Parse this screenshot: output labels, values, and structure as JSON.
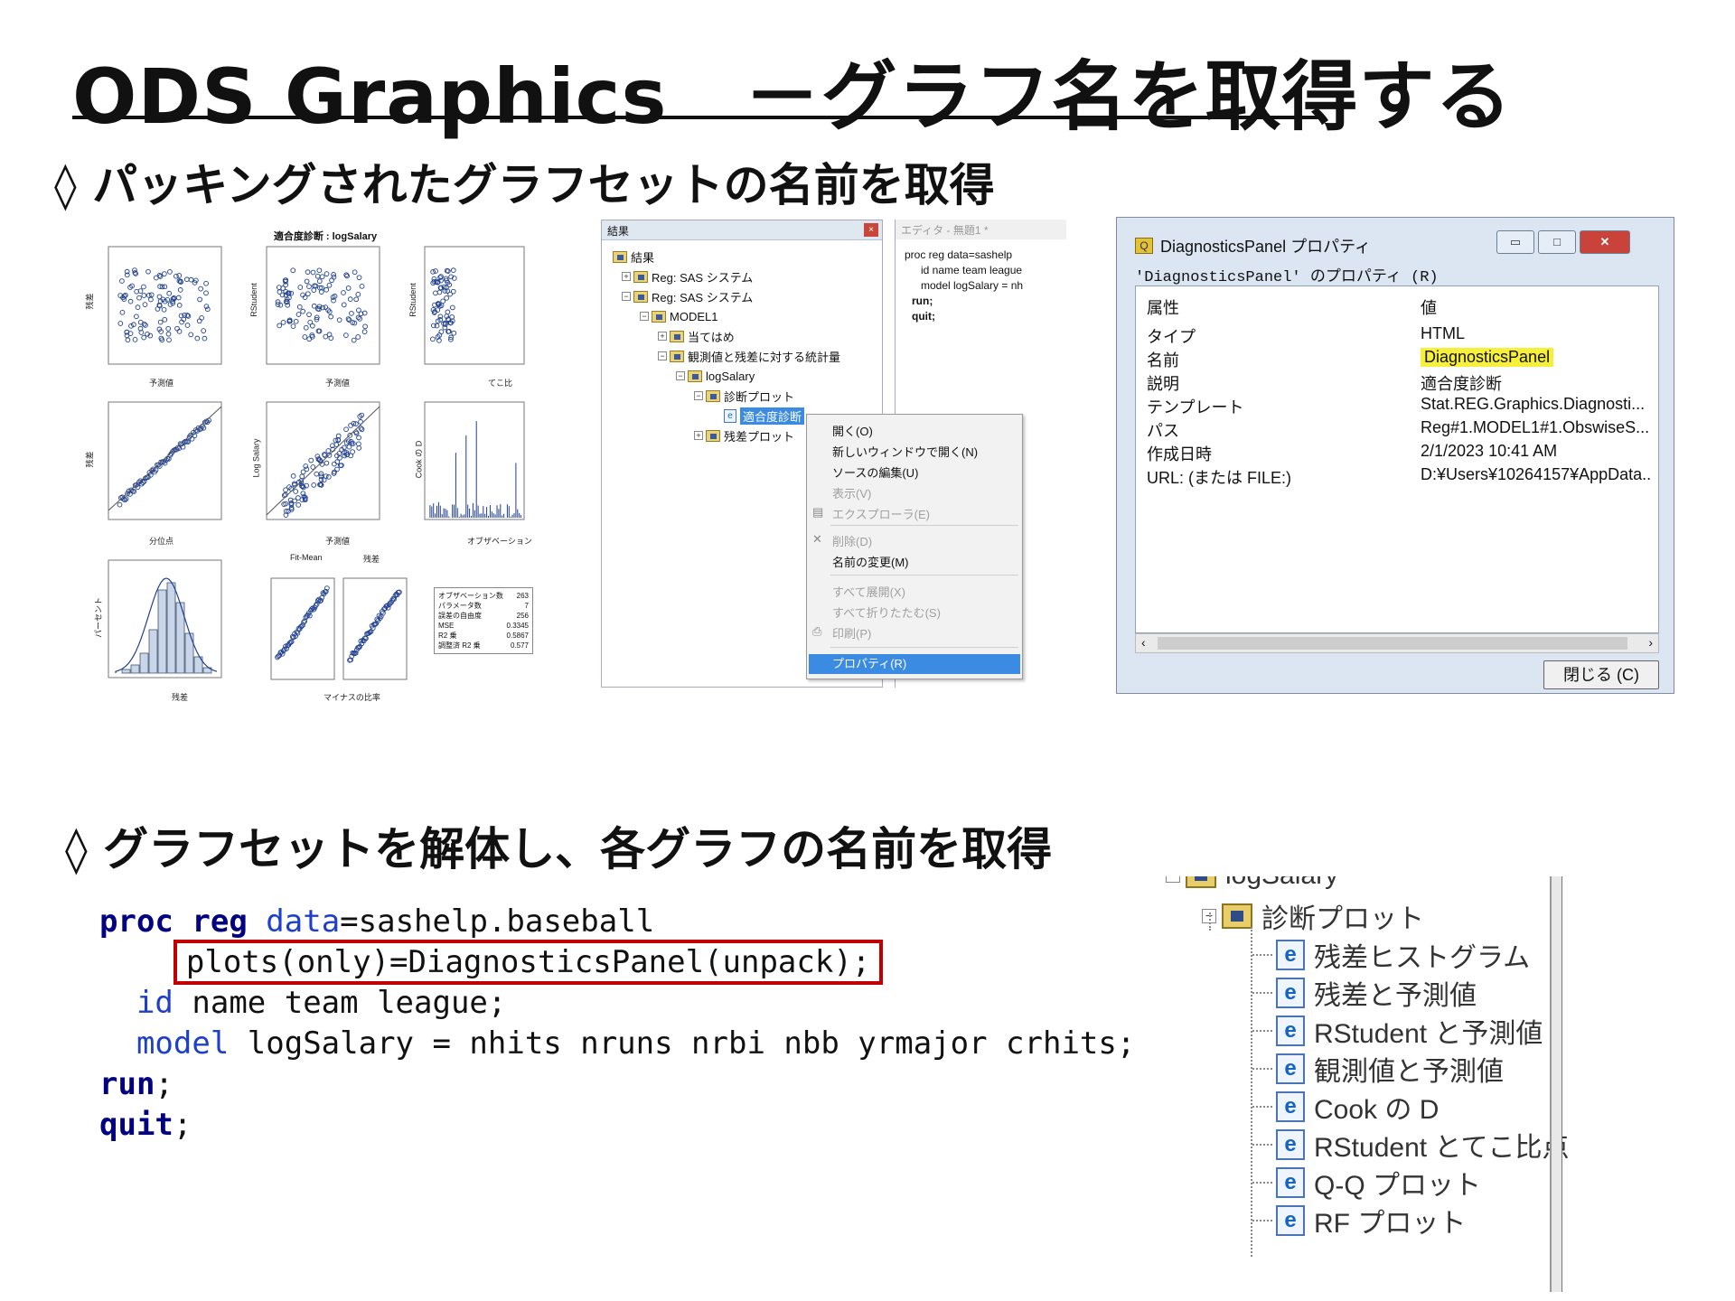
{
  "slide": {
    "title": "ODS Graphics　－グラフ名を取得する",
    "heading1": "◊ パッキングされたグラフセットの名前を取得",
    "heading2": "◊ グラフセットを解体し、各グラフの名前を取得"
  },
  "diagnostics_panel": {
    "title": "適合度診断 : logSalary",
    "captions": {
      "yhat1": "予測値",
      "yhat2": "予測値",
      "leverage": "てこ比",
      "quantile": "分位点",
      "yhat3": "予測値",
      "observation": "オブザベーション",
      "residual": "残差",
      "fitmean": "Fit-Mean",
      "residual2": "残差",
      "proportion": "マイナスの比率",
      "ylabel_resid": "残差",
      "ylabel_rstud1": "RStudent",
      "ylabel_rstud2": "RStudent",
      "ylabel_resid2": "残差",
      "ylabel_logsal": "Log Salary",
      "ylabel_cook": "Cook の D",
      "ylabel_pct": "パーセント"
    },
    "stats": [
      {
        "label": "オブザベーション数",
        "value": "263"
      },
      {
        "label": "パラメータ数",
        "value": "7"
      },
      {
        "label": "誤差の自由度",
        "value": "256"
      },
      {
        "label": "MSE",
        "value": "0.3345"
      },
      {
        "label": "R2 乗",
        "value": "0.5867"
      },
      {
        "label": "調整済 R2 乗",
        "value": "0.577"
      }
    ]
  },
  "results_window": {
    "title": "結果",
    "close": "×",
    "tree": {
      "root": "結果",
      "reg1": "Reg: SAS システム",
      "reg2": "Reg: SAS システム",
      "model": "MODEL1",
      "fit": "当てはめ",
      "obsstats": "観測値と残差に対する統計量",
      "logsalary": "logSalary",
      "diagplots": "診断プロット",
      "selected": "適合度診断",
      "residplots": "残差プロット"
    }
  },
  "editor": {
    "title": "エディタ - 無題1 *",
    "lines": [
      "proc reg data=sashelp",
      "id name team league",
      "model logSalary = nh",
      "run;",
      "quit;"
    ]
  },
  "context_menu": {
    "open": "開く(O)",
    "open_new": "新しいウィンドウで開く(N)",
    "edit_source": "ソースの編集(U)",
    "view": "表示(V)",
    "explorer": "エクスプローラ(E)",
    "delete": "削除(D)",
    "rename": "名前の変更(M)",
    "expand_all": "すべて展開(X)",
    "collapse_all": "すべて折りたたむ(S)",
    "print": "印刷(P)",
    "properties": "プロパティ(R)"
  },
  "properties_dialog": {
    "title": "DiagnosticsPanel プロパティ",
    "caption": "'DiagnosticsPanel' のプロパティ (R)",
    "header_key": "属性",
    "header_val": "値",
    "rows": [
      {
        "key": "タイプ",
        "value": "HTML"
      },
      {
        "key": "名前",
        "value": "DiagnosticsPanel"
      },
      {
        "key": "説明",
        "value": "適合度診断"
      },
      {
        "key": "テンプレート",
        "value": "Stat.REG.Graphics.Diagnosti..."
      },
      {
        "key": "パス",
        "value": "Reg#1.MODEL1#1.ObswiseS..."
      },
      {
        "key": "作成日時",
        "value": "2/1/2023 10:41 AM"
      },
      {
        "key": "URL: (または FILE:)",
        "value": "D:¥Users¥10264157¥AppData.."
      }
    ],
    "close_button": "閉じる (C)",
    "highlight_color": "#f6f03a"
  },
  "code": {
    "l1_kw1": "proc",
    "l1_kw2": "reg",
    "l1_kw3": "data",
    "l1_rest": "=sashelp.baseball",
    "l2": "plots(only)=DiagnosticsPanel(unpack);",
    "l3_kw": "id",
    "l3_rest": " name team league;",
    "l4_kw": "model",
    "l4_rest": " logSalary = nhits nruns nrbi nbb yrmajor crhits;",
    "l5_kw": "run",
    "l5_rest": ";",
    "l6_kw": "quit",
    "l6_rest": ";",
    "box_color": "#c00000"
  },
  "tree2": {
    "logsalary": "logSalary",
    "diagplots": "診断プロット",
    "items": [
      "残差ヒストグラム",
      "残差と予測値",
      "RStudent と予測値",
      "観測値と予測値",
      "Cook の D",
      "RStudent とてこ比点",
      "Q-Q プロット",
      "RF プロット"
    ]
  }
}
